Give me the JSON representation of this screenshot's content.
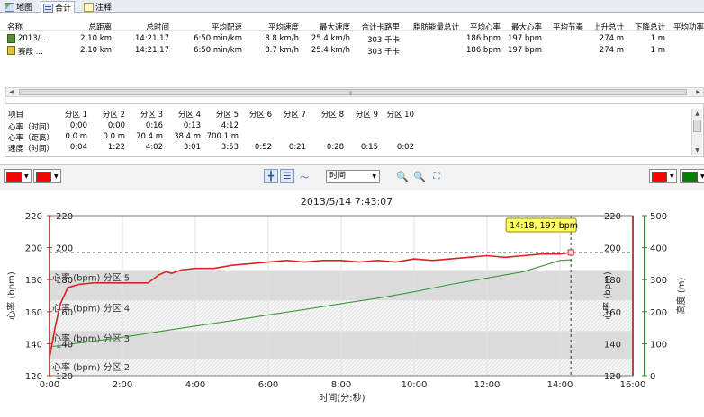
{
  "tabs": [
    {
      "label": "地图",
      "icon": "map-icon"
    },
    {
      "label": "合计",
      "icon": "summary-icon"
    },
    {
      "label": "注释",
      "icon": "notes-icon"
    }
  ],
  "summary": {
    "headers": [
      "名称",
      "总距离",
      "总时间",
      "平均配速",
      "平均速度",
      "最大速度",
      "合计卡路里",
      "脂肪能量总计",
      "平均心率",
      "最大心率",
      "平均节奏",
      "上升总计",
      "下降总计",
      "平均功率"
    ],
    "rows": [
      {
        "name": "2013/...",
        "icon": "activity-icon",
        "distance": "2.10 km",
        "time": "14:21.17",
        "pace": "6:50 min/km",
        "avg_speed": "8.8 km/h",
        "max_speed": "25.4 km/h",
        "calories": "303 千卡",
        "fat": "",
        "avg_hr": "186 bpm",
        "max_hr": "197 bpm",
        "cadence": "",
        "ascent": "274 m",
        "descent": "1 m",
        "power": ""
      },
      {
        "name": "赛段 ...",
        "icon": "lap-icon",
        "distance": "2.10 km",
        "time": "14:21.17",
        "pace": "6:50 min/km",
        "avg_speed": "8.7 km/h",
        "max_speed": "25.4 km/h",
        "calories": "303 千卡",
        "fat": "",
        "avg_hr": "186 bpm",
        "max_hr": "197 bpm",
        "cadence": "",
        "ascent": "274 m",
        "descent": "1 m",
        "power": ""
      }
    ]
  },
  "zones": {
    "headers": [
      "项目",
      "分区 1",
      "分区 2",
      "分区 3",
      "分区 4",
      "分区 5",
      "分区 6",
      "分区 7",
      "分区 8",
      "分区 9",
      "分区 10"
    ],
    "rows": [
      {
        "label": "心率（时间）",
        "values": [
          "0:00",
          "0:00",
          "0:16",
          "0:13",
          "4:12",
          "",
          "",
          "",
          "",
          ""
        ]
      },
      {
        "label": "心率（距离）",
        "values": [
          "0.0 m",
          "0.0 m",
          "70.4 m",
          "38.4 m",
          "700.1 m",
          "",
          "",
          "",
          "",
          ""
        ]
      },
      {
        "label": "速度（时间）",
        "values": [
          "0:04",
          "1:22",
          "4:02",
          "3:01",
          "3:53",
          "0:52",
          "0:21",
          "0:28",
          "0:15",
          "0:02"
        ]
      }
    ]
  },
  "toolbar": {
    "left_color_1": "#ff0000",
    "left_color_2": "#ff0000",
    "right_color_1": "#ff0000",
    "right_color_2": "#008000",
    "x_axis_option": "时间"
  },
  "chart_data": {
    "type": "line",
    "title": "2013/5/14 7:43:07",
    "xlabel": "时间(分:秒)",
    "ylabel_left": "心率 (bpm)",
    "ylabel_right_inner": "心率 (bpm)",
    "ylabel_right_outer": "高度 (m)",
    "xlim_min": [
      0,
      16
    ],
    "x_ticks": [
      "0:00",
      "2:00",
      "4:00",
      "6:00",
      "8:00",
      "10:00",
      "12:00",
      "14:00",
      "16:00"
    ],
    "ylim_hr": [
      120,
      220
    ],
    "y_ticks_hr": [
      "120",
      "140",
      "160",
      "180",
      "200",
      "220"
    ],
    "ylim_elev": [
      0,
      500
    ],
    "y_ticks_elev": [
      "0",
      "100",
      "200",
      "300",
      "400",
      "500"
    ],
    "hr_zones": [
      {
        "label": "心率 (bpm) 分区 5",
        "range": [
          167,
          186
        ]
      },
      {
        "label": "心率 (bpm) 分区 4",
        "range": [
          148,
          167
        ]
      },
      {
        "label": "心率 (bpm) 分区 3",
        "range": [
          130,
          148
        ]
      },
      {
        "label": "心率 (bpm) 分区 2",
        "range": [
          120,
          130
        ]
      }
    ],
    "series": [
      {
        "name": "心率",
        "color": "#dd2222",
        "x": [
          0,
          0.15,
          0.3,
          0.5,
          0.8,
          1.2,
          1.7,
          2.2,
          2.7,
          3.0,
          3.2,
          3.35,
          3.6,
          4.0,
          4.5,
          5.0,
          5.5,
          6.0,
          6.5,
          7.0,
          7.5,
          8.0,
          8.5,
          9.0,
          9.5,
          10.0,
          10.5,
          11.0,
          11.5,
          12.0,
          12.5,
          13.0,
          13.5,
          14.0,
          14.3
        ],
        "y": [
          131,
          150,
          165,
          175,
          177,
          178,
          178,
          178,
          178,
          183,
          185,
          184,
          186,
          187,
          187,
          189,
          190,
          191,
          192,
          191,
          192,
          192,
          191,
          192,
          191,
          193,
          192,
          193,
          194,
          195,
          194,
          195,
          196,
          196,
          197
        ]
      },
      {
        "name": "高度",
        "color": "#3a9a3a",
        "x": [
          0,
          1,
          2,
          3,
          4,
          5,
          6,
          7,
          8,
          9,
          10,
          11,
          12,
          13,
          14,
          14.3
        ],
        "y": [
          90,
          105,
          120,
          138,
          155,
          172,
          190,
          207,
          225,
          242,
          262,
          285,
          305,
          325,
          360,
          362
        ]
      }
    ],
    "marker": {
      "label": "14:18, 197 bpm",
      "x": 14.3,
      "y": 197
    },
    "reference_line_hr": 197
  }
}
